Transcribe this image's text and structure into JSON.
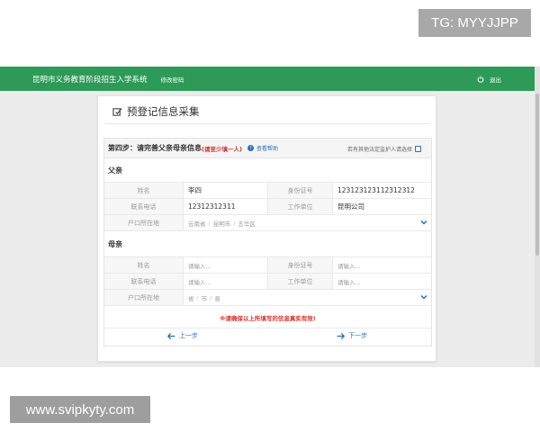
{
  "watermark": {
    "tg": "TG: MYYJJPP",
    "site": "www.svipkyty.com"
  },
  "navbar": {
    "title": "昆明市义务教育阶段招生入学系统",
    "change_password": "修改密码",
    "logout": "退出",
    "logout_icon": "power-icon",
    "bg_color": "#2e9a58"
  },
  "card": {
    "title": "预登记信息采集",
    "title_icon": "edit-icon"
  },
  "step": {
    "title": "第四步：请完善父亲母亲信息",
    "note": "(请至少填一人)",
    "help": "查看帮助",
    "guardian_label": "若有其他法定监护人请选择"
  },
  "father": {
    "section": "父亲",
    "name_label": "姓名",
    "name_value": "李四",
    "id_label": "身份证号",
    "id_value": "123123123112312312",
    "phone_label": "联系电话",
    "phone_value": "12312312311",
    "work_label": "工作单位",
    "work_value": "昆明公司",
    "hukou_label": "户口所在地",
    "hukou": {
      "province": "云南省",
      "city": "昆明市",
      "district": "五华区"
    }
  },
  "mother": {
    "section": "母亲",
    "name_label": "姓名",
    "name_placeholder": "请输入...",
    "id_label": "身份证号",
    "id_placeholder": "请输入...",
    "phone_label": "联系电话",
    "phone_placeholder": "请输入...",
    "work_label": "工作单位",
    "work_placeholder": "请输入...",
    "hukou_label": "户口所在地",
    "hukou": {
      "province": "省",
      "city": "市",
      "district": "县"
    }
  },
  "warning": "※请确保以上所填写的信息真实有效!",
  "pager": {
    "prev": "上一步",
    "next": "下一步"
  },
  "colors": {
    "accent_blue": "#2a6ebb",
    "warning_red": "#d9332c"
  }
}
